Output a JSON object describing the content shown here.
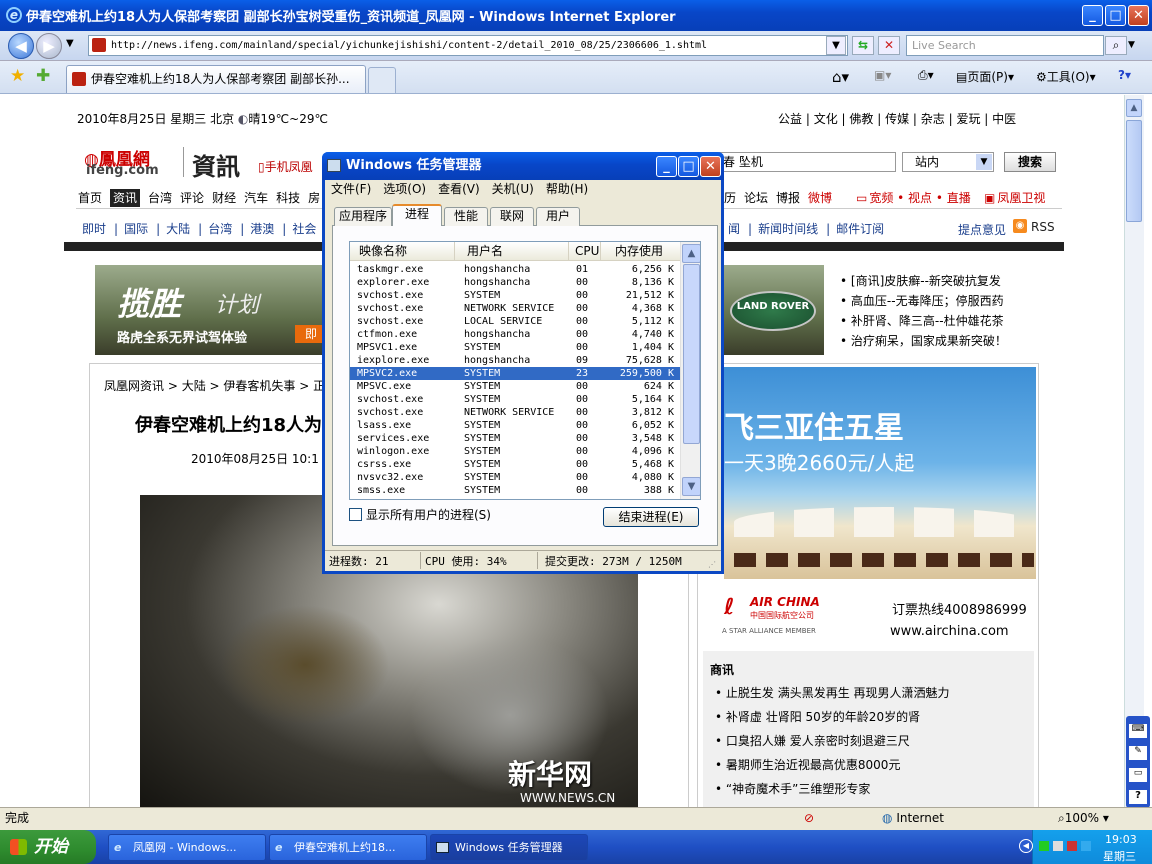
{
  "window": {
    "title": "伊春空难机上约18人为人保部考察团 副部长孙宝树受重伤_资讯频道_凤凰网 - Windows Internet Explorer"
  },
  "nav": {
    "url": "http://news.ifeng.com/mainland/special/yichunkejishishi/content-2/detail_2010_08/25/2306606_1.shtml",
    "search_placeholder": "Live Search"
  },
  "tabs": {
    "tab1_label": "伊春空难机上约18人为人保部考察团 副部长孙...",
    "toolbar": [
      "页面(P)",
      "工具(O)"
    ]
  },
  "page": {
    "date": "2010年8月25日 星期三   北京",
    "weather": "晴19℃~29℃",
    "top_links": [
      "公益",
      "文化",
      "佛教",
      "传媒",
      "杂志",
      "爱玩",
      "中医"
    ],
    "logo_cn": "鳳凰網",
    "logo_en": "ifeng.com",
    "channel": "資訊",
    "mobile_link": "手机凤凰",
    "search_value": "春 坠机",
    "search_scope": "站内",
    "search_button": "搜索",
    "nav_main": [
      "首页",
      "资讯",
      "台湾",
      "评论",
      "财经",
      "汽车",
      "科技",
      "房"
    ],
    "nav_right": [
      "历",
      "论坛",
      "博报",
      "微博"
    ],
    "nav_video": "宽频 • 视点 • 直播",
    "nav_tv": "凤凰卫视",
    "sub_nav": [
      "即时",
      "国际",
      "大陆",
      "台湾",
      "港澳",
      "社会",
      "图"
    ],
    "sub_nav_right": [
      "闻",
      "新闻时间线",
      "邮件订阅"
    ],
    "feedback": "提点意见",
    "rss": "RSS",
    "ad_banner_big": "揽胜",
    "ad_banner_small": "计划",
    "ad_banner_sub": "路虎全系无界试驾体验",
    "ad_banner_btn": "即",
    "ad_land_rover": "LAND ROVER",
    "ad_links": [
      "[商讯]皮肤癣--新突破抗复发",
      "高血压--无毒降压；停服西药",
      "补肝肾、降三高--杜仲雄花茶",
      "治疗痢呆，国家成果新突破！"
    ],
    "breadcrumb": [
      "凤凰网资讯",
      "大陆",
      "伊春客机失事",
      "正"
    ],
    "article_title": "伊春空难机上约18人为",
    "article_time": "2010年08月25日 10:1",
    "photo_watermark": "新华网",
    "photo_watermark_url": "WWW.NEWS.CN",
    "ad_sanya_1": "飞三亚住五星",
    "ad_sanya_2": "一天3晚2660元/人起",
    "ad_airchina": "AIR CHINA",
    "ad_airchina_cn": "中国国际航空公司",
    "ad_alliance": "A STAR ALLIANCE MEMBER",
    "ad_hotline": "订票热线4008986999",
    "ad_site": "www.airchina.com",
    "promo_title": "商讯",
    "promo_items": [
      "止脱生发 满头黑发再生 再现男人潇洒魅力",
      "补肾虚 壮肾阳 50岁的年龄20岁的肾",
      "口臭招人嫌 爱人亲密时刻退避三尺",
      "暑期师生治近视最高优惠8000元",
      "“神奇魔术手”三维塑形专家"
    ]
  },
  "taskmgr": {
    "title": "Windows 任务管理器",
    "menu": [
      "文件(F)",
      "选项(O)",
      "查看(V)",
      "关机(U)",
      "帮助(H)"
    ],
    "tabs": [
      "应用程序",
      "进程",
      "性能",
      "联网",
      "用户"
    ],
    "columns": [
      "映像名称",
      "用户名",
      "CPU",
      "内存使用"
    ],
    "processes": [
      {
        "name": "taskmgr.exe",
        "user": "hongshancha",
        "cpu": "01",
        "mem": "6,256 K"
      },
      {
        "name": "explorer.exe",
        "user": "hongshancha",
        "cpu": "00",
        "mem": "8,136 K"
      },
      {
        "name": "svchost.exe",
        "user": "SYSTEM",
        "cpu": "00",
        "mem": "21,512 K"
      },
      {
        "name": "svchost.exe",
        "user": "NETWORK SERVICE",
        "cpu": "00",
        "mem": "4,368 K"
      },
      {
        "name": "svchost.exe",
        "user": "LOCAL SERVICE",
        "cpu": "00",
        "mem": "5,112 K"
      },
      {
        "name": "ctfmon.exe",
        "user": "hongshancha",
        "cpu": "00",
        "mem": "4,740 K"
      },
      {
        "name": "MPSVC1.exe",
        "user": "SYSTEM",
        "cpu": "00",
        "mem": "1,404 K"
      },
      {
        "name": "iexplore.exe",
        "user": "hongshancha",
        "cpu": "09",
        "mem": "75,628 K"
      },
      {
        "name": "MPSVC2.exe",
        "user": "SYSTEM",
        "cpu": "23",
        "mem": "259,500 K"
      },
      {
        "name": "MPSVC.exe",
        "user": "SYSTEM",
        "cpu": "00",
        "mem": "624 K"
      },
      {
        "name": "svchost.exe",
        "user": "SYSTEM",
        "cpu": "00",
        "mem": "5,164 K"
      },
      {
        "name": "svchost.exe",
        "user": "NETWORK SERVICE",
        "cpu": "00",
        "mem": "3,812 K"
      },
      {
        "name": "lsass.exe",
        "user": "SYSTEM",
        "cpu": "00",
        "mem": "6,052 K"
      },
      {
        "name": "services.exe",
        "user": "SYSTEM",
        "cpu": "00",
        "mem": "3,548 K"
      },
      {
        "name": "winlogon.exe",
        "user": "SYSTEM",
        "cpu": "00",
        "mem": "4,096 K"
      },
      {
        "name": "csrss.exe",
        "user": "SYSTEM",
        "cpu": "00",
        "mem": "5,468 K"
      },
      {
        "name": "nvsvc32.exe",
        "user": "SYSTEM",
        "cpu": "00",
        "mem": "4,080 K"
      },
      {
        "name": "smss.exe",
        "user": "SYSTEM",
        "cpu": "00",
        "mem": "388 K"
      }
    ],
    "selected_process": "MPSVC2.exe",
    "show_all_label": "显示所有用户的进程(S)",
    "end_process_button": "结束进程(E)",
    "status_processes": "进程数: 21",
    "status_cpu": "CPU 使用: 34%",
    "status_commit": "提交更改: 273M / 1250M"
  },
  "statusbar": {
    "status": "完成",
    "zone": "Internet",
    "zoom": "100%"
  },
  "taskbar": {
    "start_label": "开始",
    "tasks": [
      "凤凰网 - Windows...",
      "伊春空难机上约18...",
      "Windows 任务管理器"
    ],
    "time": "19:03",
    "day": "星期三"
  }
}
